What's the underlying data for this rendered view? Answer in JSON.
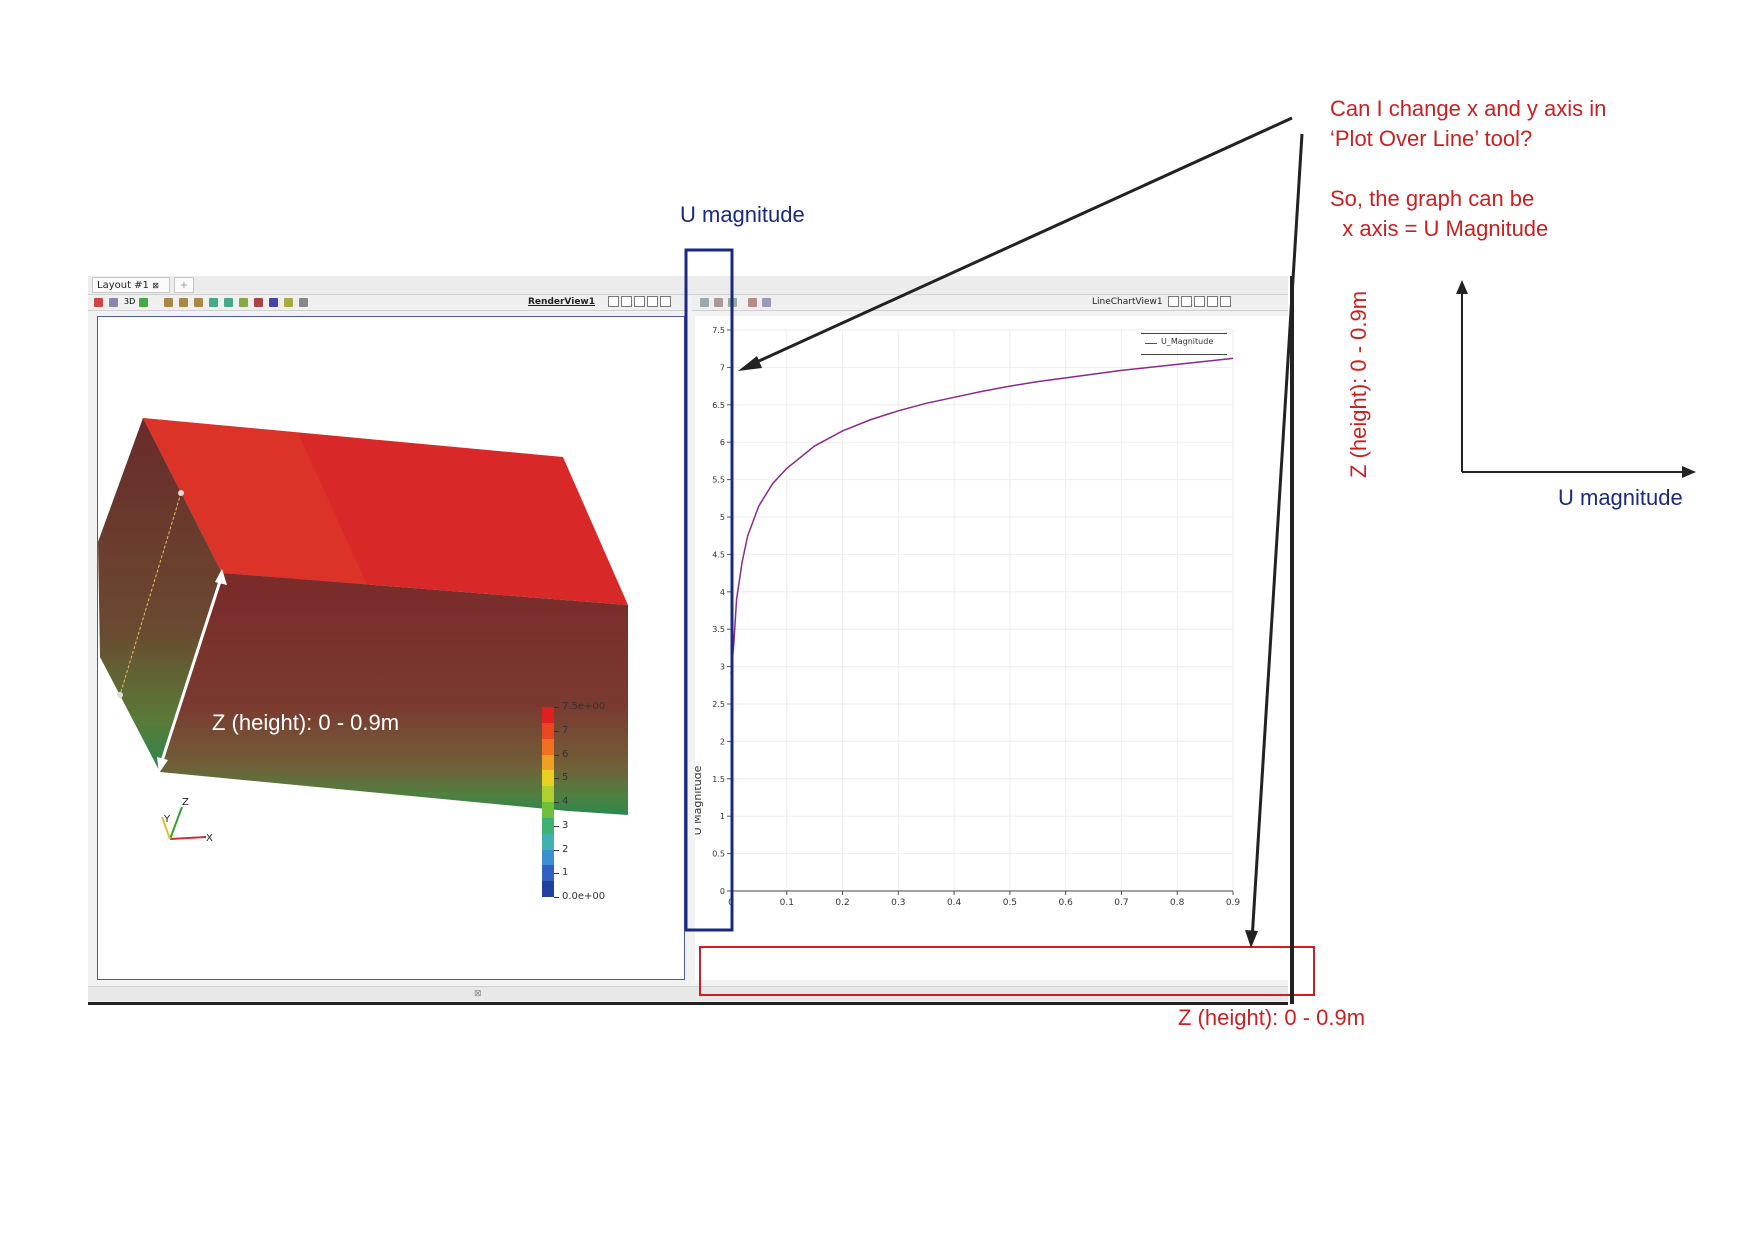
{
  "window": {
    "tabs": [
      {
        "label": "Layout #1"
      },
      {
        "label": "+"
      }
    ],
    "render_view": {
      "title": "RenderView1",
      "toolbar_buttons": [
        "reset-camera-icon",
        "zoom-icon",
        "3D",
        "orient-icon",
        "select-cells-icon",
        "select-points-icon",
        "select-frustum-icon",
        "select-blocks-icon",
        "interactive-select-icon",
        "hover-icon",
        "grow-icon",
        "shrink-icon",
        "clear-selection-icon",
        "delete-icon"
      ]
    },
    "line_chart_view": {
      "title": "LineChartView1"
    }
  },
  "colorbar": {
    "labels": [
      "7.5e+00",
      "7",
      "6",
      "5",
      "4",
      "3",
      "2",
      "1",
      "0.0e+00"
    ],
    "colors": [
      "#e02020",
      "#e84820",
      "#f07020",
      "#f0a020",
      "#e8d020",
      "#b0d030",
      "#70c040",
      "#40b070",
      "#40b0b0",
      "#3c90d0",
      "#3060c0",
      "#2040a0"
    ]
  },
  "chart_data": {
    "type": "line",
    "xlabel": "",
    "ylabel": "U Magnitude",
    "xlim": [
      0,
      0.9
    ],
    "ylim": [
      0,
      7.5
    ],
    "x_ticks": [
      "0",
      "0.1",
      "0.2",
      "0.3",
      "0.4",
      "0.5",
      "0.6",
      "0.7",
      "0.8",
      "0.9"
    ],
    "y_ticks": [
      "0",
      "0.5",
      "1",
      "1.5",
      "2",
      "2.5",
      "3",
      "3.5",
      "4",
      "4.5",
      "5",
      "5.5",
      "6",
      "6.5",
      "7",
      "7.5"
    ],
    "grid": true,
    "legend_position": "top-right",
    "series": [
      {
        "name": "U_Magnitude",
        "color": "#8a2a8a",
        "x": [
          0.0,
          0.005,
          0.01,
          0.02,
          0.03,
          0.05,
          0.075,
          0.1,
          0.15,
          0.2,
          0.25,
          0.3,
          0.35,
          0.4,
          0.45,
          0.5,
          0.55,
          0.6,
          0.65,
          0.7,
          0.75,
          0.8,
          0.85,
          0.9
        ],
        "y": [
          2.9,
          3.3,
          3.9,
          4.4,
          4.75,
          5.15,
          5.45,
          5.65,
          5.95,
          6.15,
          6.3,
          6.42,
          6.52,
          6.6,
          6.68,
          6.75,
          6.81,
          6.86,
          6.91,
          6.96,
          7.0,
          7.04,
          7.08,
          7.12
        ]
      }
    ]
  },
  "annotations": {
    "u_magnitude_top": "U magnitude",
    "question_line1": "Can I change x and y axis in",
    "question_line2": "‘Plot Over Line’ tool?",
    "suggest_line1": "So, the graph can be",
    "suggest_line2": "  x axis = U Magnitude",
    "axis_y_label": "Z (height): 0 - 0.9m",
    "axis_x_label": "U magnitude",
    "render_height_label": "Z (height): 0 - 0.9m",
    "bottom_z_label": "Z (height): 0 - 0.9m",
    "colors": {
      "red": "#cc2020",
      "blue": "#1a2a80"
    }
  }
}
